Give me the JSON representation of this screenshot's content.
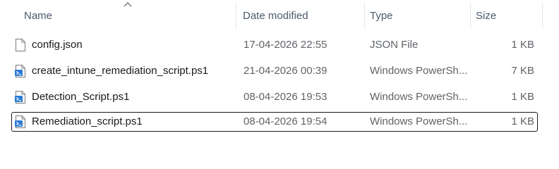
{
  "columns": {
    "name": "Name",
    "date": "Date modified",
    "type": "Type",
    "size": "Size"
  },
  "sort": {
    "column": "name",
    "icon": "sort-up-chevron-icon"
  },
  "files": [
    {
      "name": "config.json",
      "date": "17-04-2026 22:55",
      "type": "JSON File",
      "size": "1 KB",
      "icon": "json-file-icon",
      "focused": false
    },
    {
      "name": "create_intune_remediation_script.ps1",
      "date": "21-04-2026 00:39",
      "type": "Windows PowerSh...",
      "size": "7 KB",
      "icon": "powershell-file-icon",
      "focused": false
    },
    {
      "name": "Detection_Script.ps1",
      "date": "08-04-2026 19:53",
      "type": "Windows PowerSh...",
      "size": "1 KB",
      "icon": "powershell-file-icon",
      "focused": false
    },
    {
      "name": "Remediation_script.ps1",
      "date": "08-04-2026 19:54",
      "type": "Windows PowerSh...",
      "size": "1 KB",
      "icon": "powershell-file-icon",
      "focused": true
    }
  ],
  "colors": {
    "header_text": "#4c5b6e",
    "focus_border": "#1b1b1b",
    "ps_icon_blue": "#2b7bd6"
  }
}
